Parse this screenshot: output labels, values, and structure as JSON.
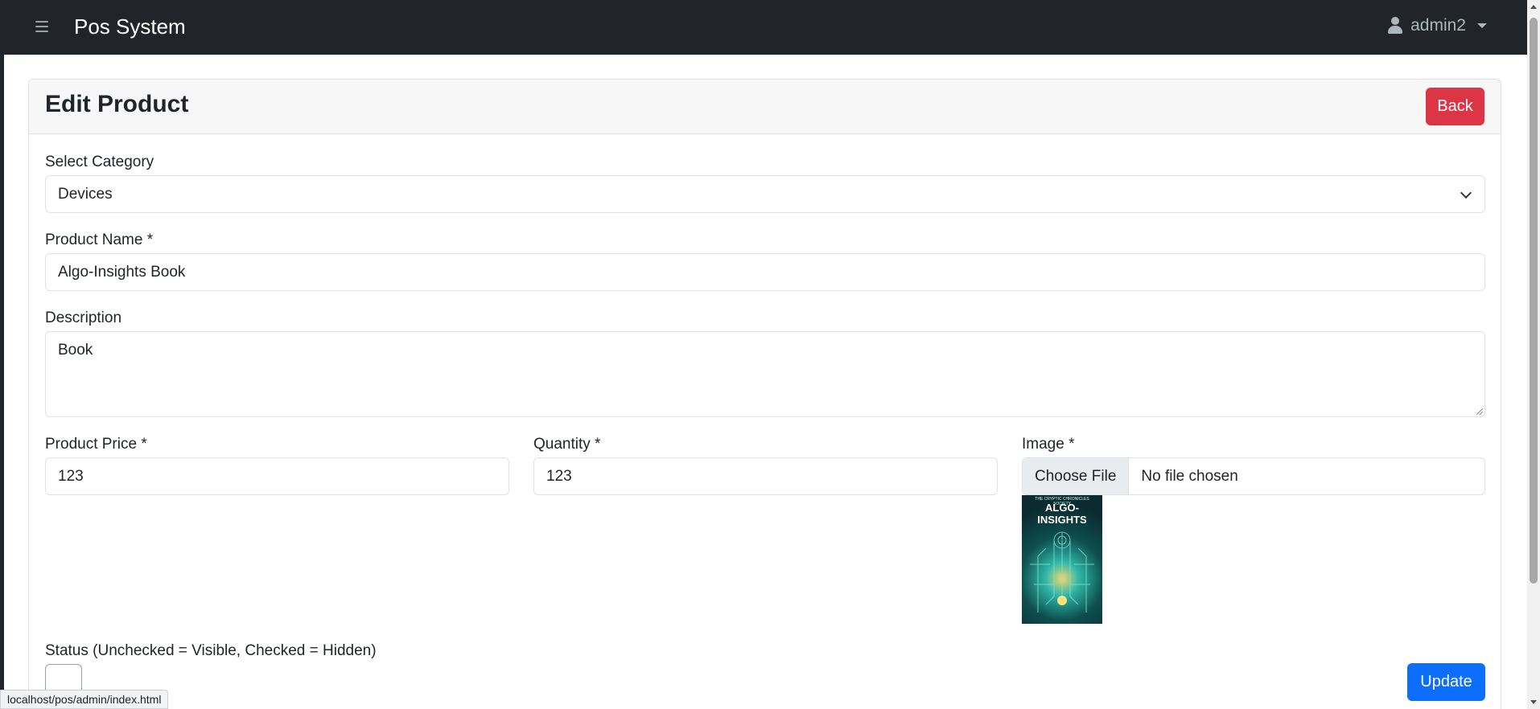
{
  "navbar": {
    "brand": "Pos System",
    "user": "admin2"
  },
  "card": {
    "title": "Edit Product",
    "back_label": "Back",
    "update_label": "Update"
  },
  "form": {
    "category_label": "Select Category",
    "category_value": "Devices",
    "name_label": "Product Name *",
    "name_value": "Algo-Insights Book",
    "description_label": "Description",
    "description_value": "Book",
    "price_label": "Product Price *",
    "price_value": "123",
    "quantity_label": "Quantity *",
    "quantity_value": "123",
    "image_label": "Image *",
    "choose_file_label": "Choose File",
    "file_status": "No file chosen",
    "status_label": "Status (Unchecked = Visible, Checked = Hidden)",
    "status_checked": false
  },
  "image_preview": {
    "cover_title": "ALGO-INSIGHTS",
    "cover_subtitle": "THE CRYPTIC CHRONICLES SOCIETY"
  },
  "status_bar": {
    "url": "localhost/pos/admin/index.html"
  },
  "colors": {
    "navbar": "#212529",
    "back_button": "#dc3545",
    "update_button": "#0d6efd"
  }
}
